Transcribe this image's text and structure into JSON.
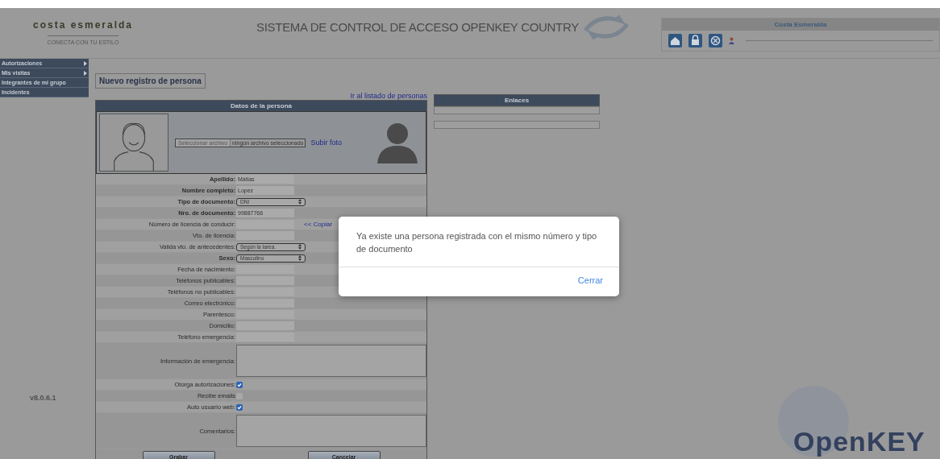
{
  "header": {
    "brand": "costa esmeralda",
    "brand_tagline": "CONECTA CON TU ESTILO",
    "title": "SISTEMA DE CONTROL DE ACCESO OPENKEY COUNTRY"
  },
  "user_panel": {
    "title": "Costa Esmeralda"
  },
  "sidebar": {
    "items": [
      {
        "label": "Autorizaciones",
        "has_submenu": true
      },
      {
        "label": "Mis visitas",
        "has_submenu": true
      },
      {
        "label": "Integrantes de mi grupo",
        "has_submenu": false
      },
      {
        "label": "Incidentes",
        "has_submenu": false
      }
    ],
    "version": "v8.0.6.1"
  },
  "page_title": "Nuevo registro de persona",
  "list_link": "Ir al listado de personas",
  "person_panel": {
    "title": "Datos de la persona",
    "file_button": "Seleccionar archivo",
    "file_status": "ningún archivo seleccionado",
    "upload_link": "Subir foto"
  },
  "fields": [
    {
      "kind": "text",
      "label": "Apellido:",
      "bold": true,
      "value": "Matias"
    },
    {
      "kind": "text",
      "label": "Nombre completo:",
      "bold": true,
      "value": "Lopez"
    },
    {
      "kind": "select",
      "label": "Tipo de documento:",
      "bold": true,
      "value": "DNI"
    },
    {
      "kind": "text",
      "label": "Nro. de documento:",
      "bold": true,
      "value": "99887766"
    },
    {
      "kind": "text",
      "label": "Número de licencia de conducir:",
      "bold": false,
      "action": "<< Copiar"
    },
    {
      "kind": "text",
      "label": "Vto. de licencia:",
      "bold": false
    },
    {
      "kind": "select",
      "label": "Valida vto. de antecedentes:",
      "bold": false,
      "value": "Según la tarea."
    },
    {
      "kind": "select",
      "label": "Sexo:",
      "bold": true,
      "value": "Masculino"
    },
    {
      "kind": "text",
      "label": "Fecha de nacimiento:",
      "bold": false
    },
    {
      "kind": "text",
      "label": "Teléfonos publicables:",
      "bold": false
    },
    {
      "kind": "text",
      "label": "Teléfonos no publicables:",
      "bold": false
    },
    {
      "kind": "text",
      "label": "Correo electrónico:",
      "bold": false
    },
    {
      "kind": "text",
      "label": "Parentesco:",
      "bold": false
    },
    {
      "kind": "text",
      "label": "Domicilio:",
      "bold": false
    },
    {
      "kind": "text",
      "label": "Teléfono emergencia:",
      "bold": false
    },
    {
      "kind": "textarea",
      "label": "Información de emergencia:",
      "bold": false
    },
    {
      "kind": "checkbox",
      "label": "Otorga autorizaciones:",
      "bold": false,
      "checked": true
    },
    {
      "kind": "checkbox",
      "label": "Recibe emails",
      "bold": false,
      "checked": false
    },
    {
      "kind": "checkbox",
      "label": "Auto usuario web:",
      "bold": false,
      "checked": true
    },
    {
      "kind": "textarea",
      "label": "Comentarios:",
      "bold": false
    }
  ],
  "buttons": [
    "Grabar",
    "Cancelar"
  ],
  "links_panel": {
    "title": "Enlaces"
  },
  "footer_logo": "OpenKEY",
  "dialog": {
    "message": "Ya existe una persona registrada con el mismo número y tipo de documento",
    "action": "Cerrar"
  }
}
